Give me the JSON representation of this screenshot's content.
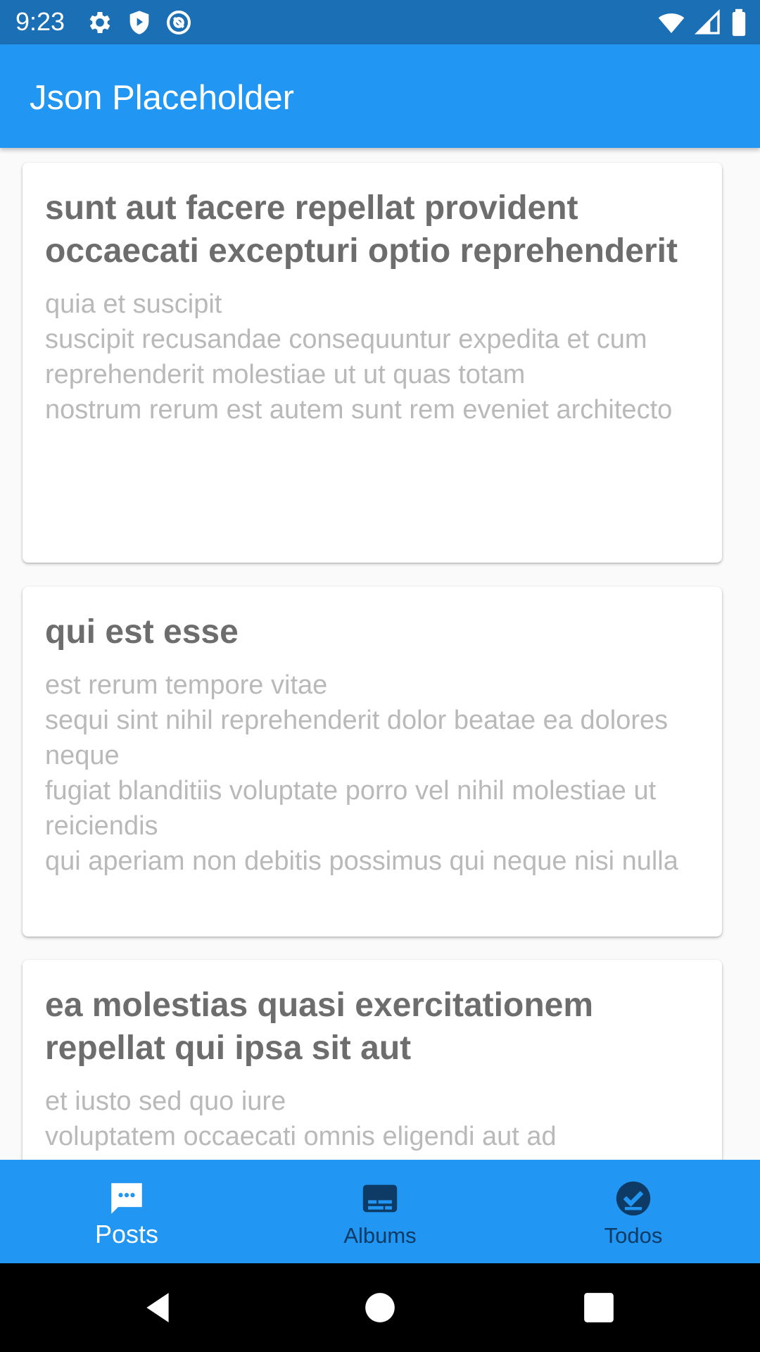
{
  "status_bar": {
    "time": "9:23",
    "icons_left": [
      "gear-icon",
      "shield-icon",
      "at-sign-icon"
    ],
    "icons_right": [
      "wifi-icon",
      "signal-icon",
      "battery-icon"
    ]
  },
  "app_bar": {
    "title": "Json Placeholder",
    "color": "#2196f3"
  },
  "posts": [
    {
      "title": "sunt aut facere repellat provident occaecati excepturi optio reprehenderit",
      "body": "quia et suscipit\nsuscipit recusandae consequuntur expedita et cum\nreprehenderit molestiae ut ut quas totam\nnostrum rerum est autem sunt rem eveniet architecto"
    },
    {
      "title": "qui est esse",
      "body": "est rerum tempore vitae\nsequi sint nihil reprehenderit dolor beatae ea dolores neque\nfugiat blanditiis voluptate porro vel nihil molestiae ut reiciendis\nqui aperiam non debitis possimus qui neque nisi nulla"
    },
    {
      "title": "ea molestias quasi exercitationem repellat qui ipsa sit aut",
      "body": "et iusto sed quo iure\nvoluptatem occaecati omnis eligendi aut ad"
    }
  ],
  "bottom_nav": {
    "items": [
      {
        "label": "Posts",
        "icon": "chat-bubble-icon",
        "active": true
      },
      {
        "label": "Albums",
        "icon": "album-icon",
        "active": false
      },
      {
        "label": "Todos",
        "icon": "check-circle-icon",
        "active": false
      }
    ]
  },
  "system_nav": {
    "icons": [
      "back-icon",
      "home-icon",
      "recents-icon"
    ]
  }
}
